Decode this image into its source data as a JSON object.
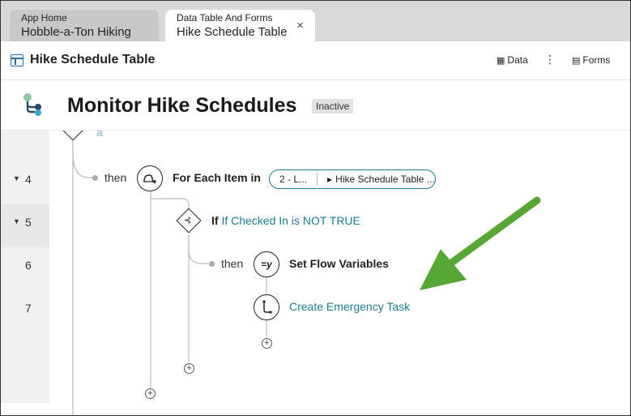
{
  "tabs": [
    {
      "small": "App Home",
      "big": "Hobble-a-Ton Hiking"
    },
    {
      "small": "Data Table And Forms",
      "big": "Hike Schedule Table",
      "close": "×"
    }
  ],
  "header": {
    "title": "Hike Schedule Table",
    "data_label": "Data",
    "forms_label": "Forms",
    "more": "⋮"
  },
  "flow": {
    "title": "Monitor Hike Schedules",
    "status": "Inactive"
  },
  "editor": {
    "faded_text": "a",
    "lines": [
      {
        "num": "4",
        "caret": "▼"
      },
      {
        "num": "5",
        "caret": "▼"
      },
      {
        "num": "6",
        "caret": ""
      },
      {
        "num": "7",
        "caret": ""
      }
    ],
    "then_label": "then",
    "for_each": {
      "keyword": "For Each Item in",
      "pill_left": "2 - L...",
      "pill_right": "Hike Schedule Table ..."
    },
    "if_node": {
      "keyword": "If",
      "condition": "If Checked In is NOT TRUE"
    },
    "set_flow": {
      "label": "Set Flow Variables",
      "icon_text": "=y"
    },
    "create_task": {
      "label": "Create Emergency Task"
    }
  },
  "colors": {
    "link": "#1d7b95",
    "arrow": "#57a735"
  }
}
